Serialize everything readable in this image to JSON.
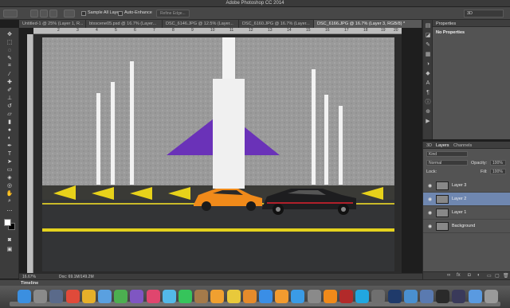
{
  "app": {
    "title": "Adobe Photoshop CC 2014"
  },
  "options_bar": {
    "sample_all_layers": "Sample All Layers",
    "auto_enhance": "Auto-Enhance",
    "refine_edge": "Refine Edge...",
    "workspace": "3D"
  },
  "tabs": [
    {
      "label": "Untitled-1 @ 25% (Layer 1, R..."
    },
    {
      "label": "btxscene05.psd @ 16.7% (Layer..."
    },
    {
      "label": "DSC_6146.JPG @ 12.5% (Layer..."
    },
    {
      "label": "DSC_6160.JPG @ 16.7% (Layer..."
    },
    {
      "label": "DSC_6166.JPG @ 16.7% (Layer 3, RGB/8) *"
    }
  ],
  "ruler_ticks": [
    "2",
    "3",
    "4",
    "5",
    "6",
    "7",
    "8",
    "9",
    "10",
    "11",
    "12",
    "13",
    "14",
    "15",
    "16",
    "17",
    "18",
    "19",
    "20"
  ],
  "status": {
    "zoom": "16.67%",
    "doc": "Doc: 69.1M/149.2M"
  },
  "timeline": {
    "label": "Timeline"
  },
  "properties": {
    "header": "Properties",
    "empty_text": "No Properties"
  },
  "layers_panel": {
    "tabs": [
      "3D",
      "Layers",
      "Channels"
    ],
    "kind": "Kind",
    "blend_mode": "Normal",
    "opacity_label": "Opacity:",
    "opacity_value": "100%",
    "lock_label": "Lock:",
    "fill_label": "Fill:",
    "fill_value": "100%",
    "layers": [
      {
        "name": "Layer 3",
        "selected": false
      },
      {
        "name": "Layer 2",
        "selected": true
      },
      {
        "name": "Layer 1",
        "selected": false
      },
      {
        "name": "Background",
        "selected": false
      }
    ]
  },
  "dock": {
    "apps": [
      {
        "icon": "finder-icon",
        "color": "#3b8fe0"
      },
      {
        "icon": "launchpad-icon",
        "color": "#8a8a8a"
      },
      {
        "icon": "rocket-icon",
        "color": "#5a6a8a"
      },
      {
        "icon": "calendar-icon",
        "color": "#e04a3a"
      },
      {
        "icon": "chrome-icon",
        "color": "#e6b02a"
      },
      {
        "icon": "mail-icon",
        "color": "#5aa0e0"
      },
      {
        "icon": "maps-icon",
        "color": "#4caf50"
      },
      {
        "icon": "app-icon",
        "color": "#7f56c2"
      },
      {
        "icon": "itunes-icon",
        "color": "#e0466e"
      },
      {
        "icon": "messages-icon",
        "color": "#53b9e8"
      },
      {
        "icon": "facetime-icon",
        "color": "#36c45b"
      },
      {
        "icon": "contacts-icon",
        "color": "#a57a4a"
      },
      {
        "icon": "photos-icon",
        "color": "#f0a030"
      },
      {
        "icon": "notes-icon",
        "color": "#e8c93b"
      },
      {
        "icon": "books-icon",
        "color": "#e58b2b"
      },
      {
        "icon": "app-store-icon",
        "color": "#3a8ee6"
      },
      {
        "icon": "ibooks-icon",
        "color": "#f29b2f"
      },
      {
        "icon": "safari-icon",
        "color": "#3a9be6"
      },
      {
        "icon": "preferences-icon",
        "color": "#8a8a8a"
      },
      {
        "icon": "vlc-icon",
        "color": "#f08a1a"
      },
      {
        "icon": "filezilla-icon",
        "color": "#b22a2a"
      },
      {
        "icon": "skype-icon",
        "color": "#21a7e0"
      },
      {
        "icon": "settings-icon",
        "color": "#6f6f6f"
      },
      {
        "icon": "photoshop-icon",
        "color": "#1f3a6a"
      },
      {
        "icon": "finder-icon",
        "color": "#4a90d0"
      },
      {
        "icon": "bluetooth-icon",
        "color": "#5a7ab0"
      },
      {
        "icon": "terminal-icon",
        "color": "#2a2a2a"
      },
      {
        "icon": "steam-icon",
        "color": "#3a3a5a"
      },
      {
        "icon": "folder-icon",
        "color": "#5a9ae0"
      },
      {
        "icon": "trash-icon",
        "color": "#9a9a9a"
      }
    ]
  }
}
